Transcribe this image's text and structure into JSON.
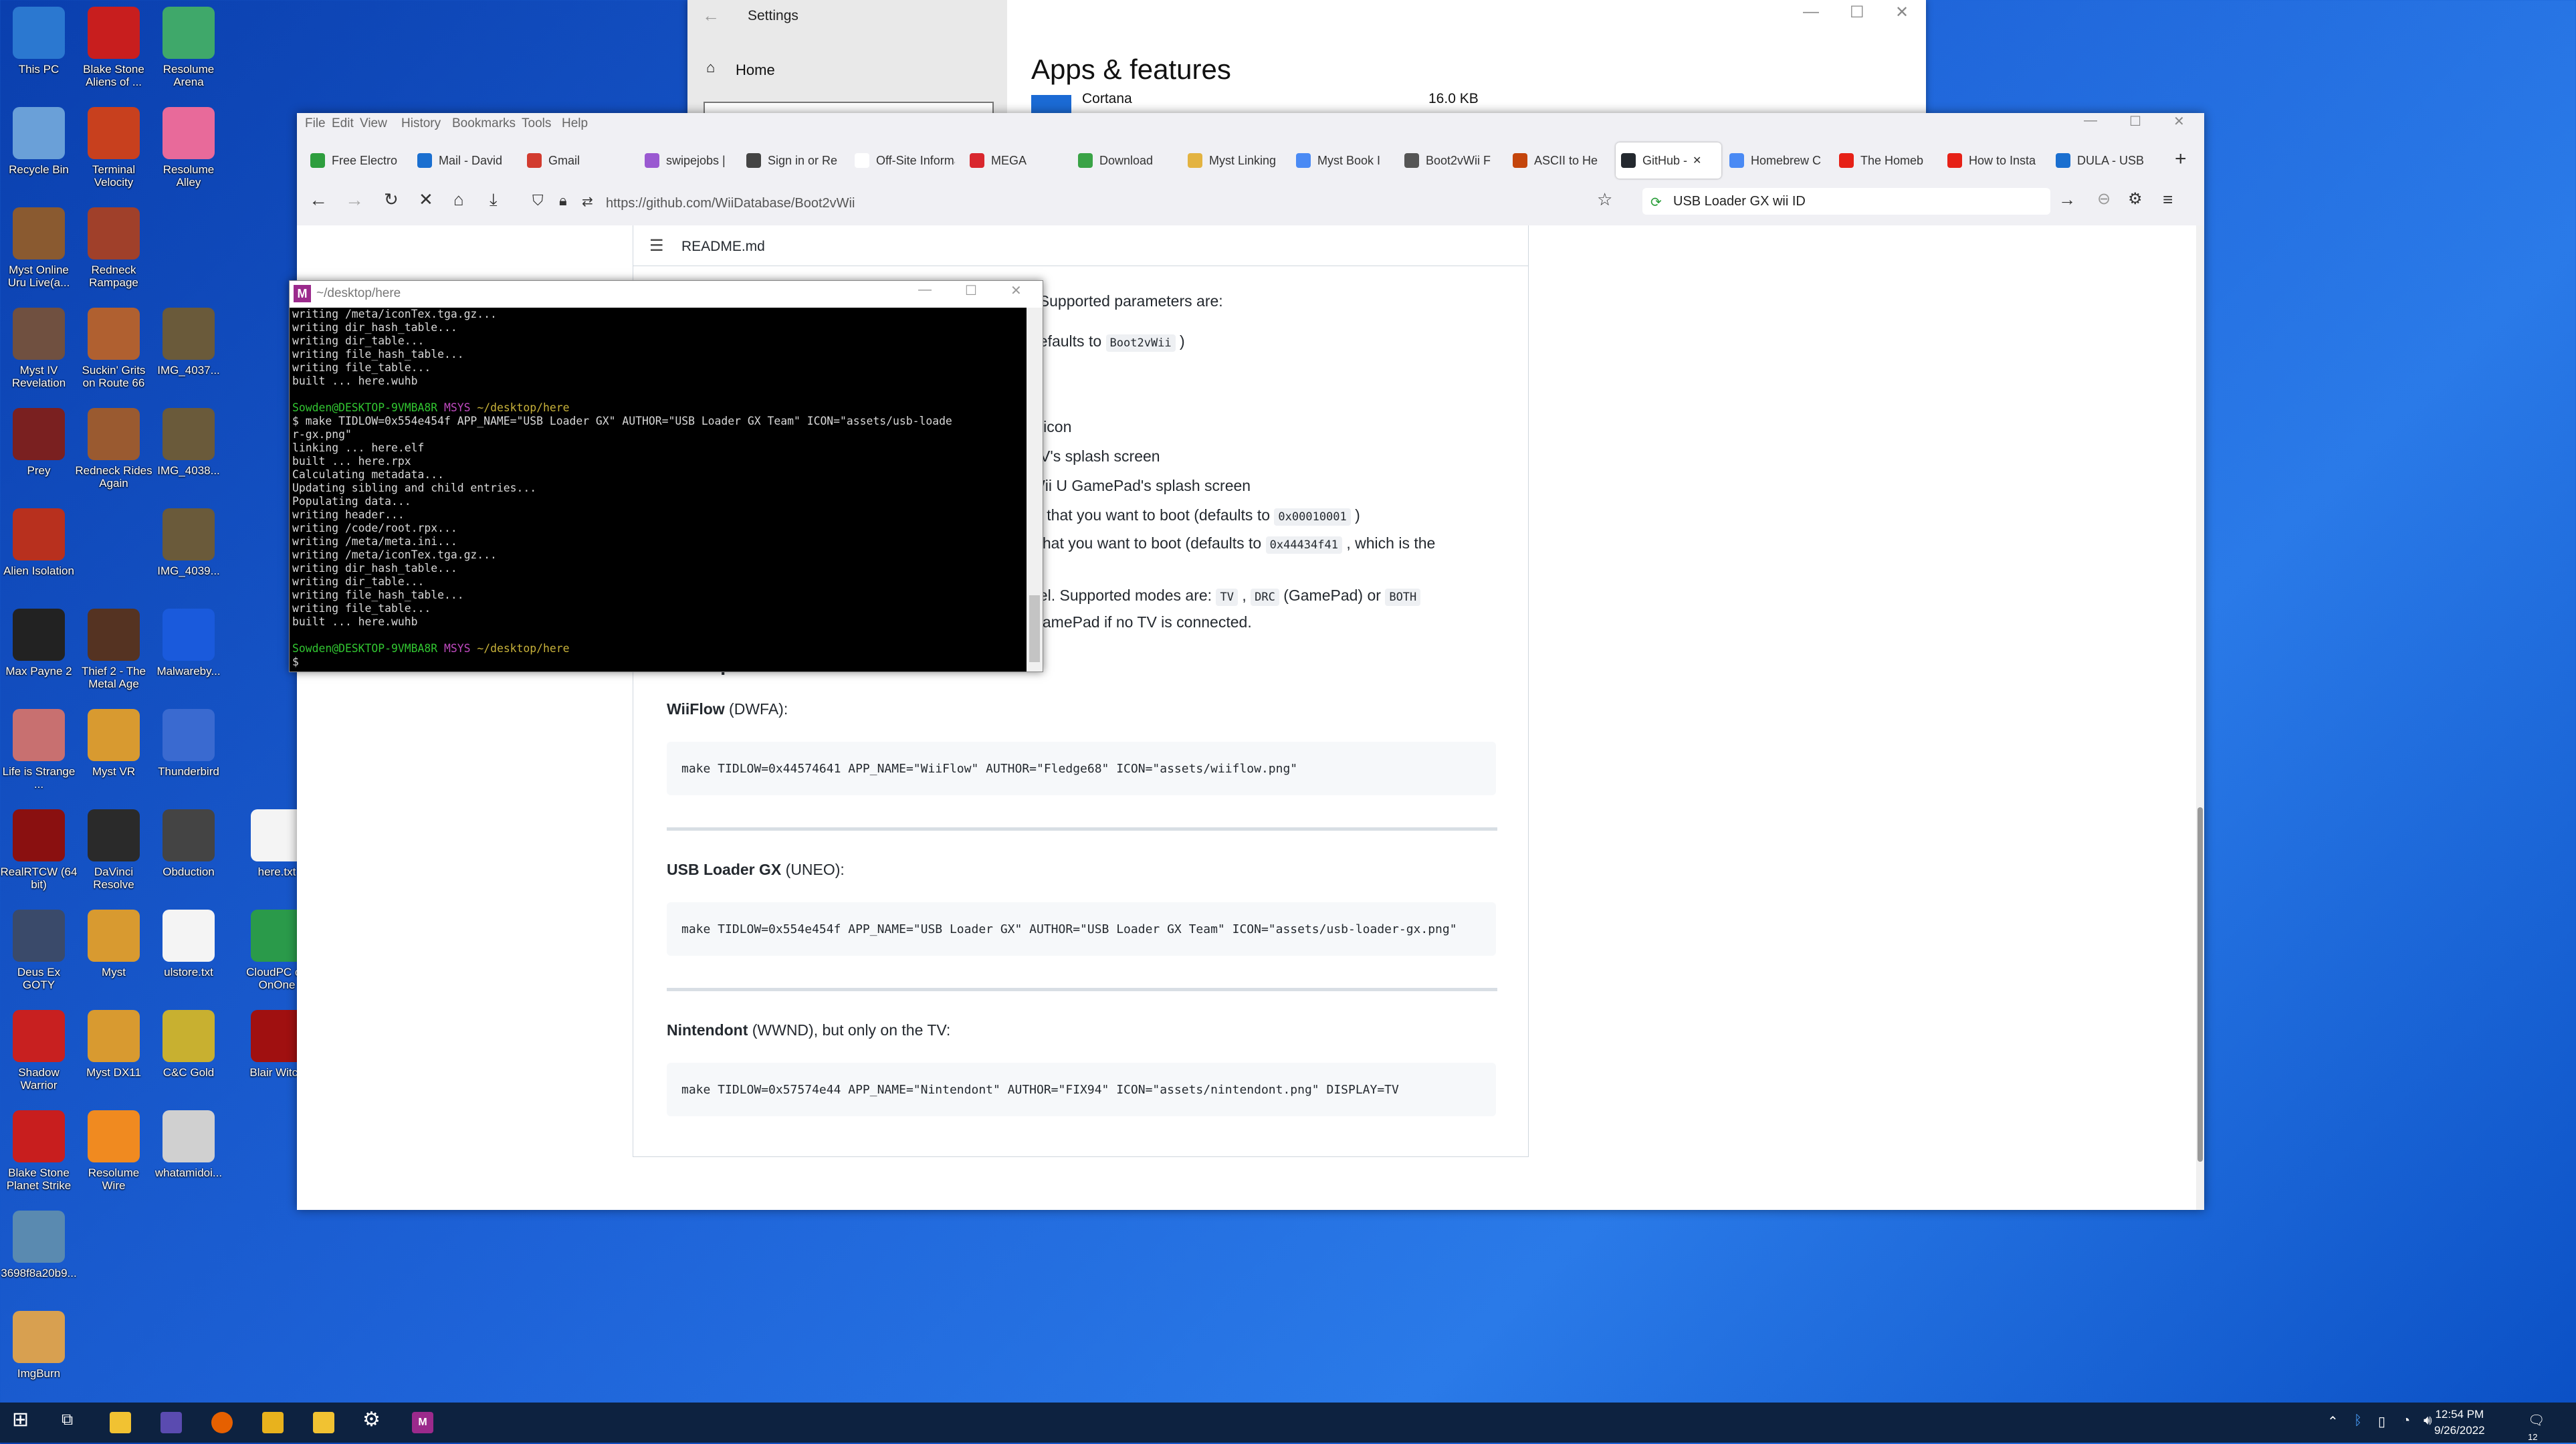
{
  "desktop": {
    "icons": [
      {
        "label": "This PC"
      },
      {
        "label": "Blake Stone Aliens of ..."
      },
      {
        "label": "Resolume Arena"
      },
      {
        "label": "Recycle Bin"
      },
      {
        "label": "Terminal Velocity"
      },
      {
        "label": "Resolume Alley"
      },
      {
        "label": "Myst Online Uru Live(a..."
      },
      {
        "label": "Redneck Rampage"
      },
      {
        "label": "Myst IV Revelation"
      },
      {
        "label": "Suckin' Grits on Route 66"
      },
      {
        "label": "IMG_4037..."
      },
      {
        "label": "Prey"
      },
      {
        "label": "Redneck Rides Again"
      },
      {
        "label": "IMG_4038..."
      },
      {
        "label": "Alien Isolation"
      },
      {
        "label": "IMG_4039..."
      },
      {
        "label": "Max Payne 2"
      },
      {
        "label": "Thief 2 - The Metal Age"
      },
      {
        "label": "Malwareby..."
      },
      {
        "label": "Life is Strange ..."
      },
      {
        "label": "Myst VR"
      },
      {
        "label": "Thunderbird"
      },
      {
        "label": "RealRTCW (64 bit)"
      },
      {
        "label": "DaVinci Resolve"
      },
      {
        "label": "Obduction"
      },
      {
        "label": "here.txt"
      },
      {
        "label": "Deus Ex GOTY"
      },
      {
        "label": "Myst"
      },
      {
        "label": "ulstore.txt"
      },
      {
        "label": "CloudPC on OnOne"
      },
      {
        "label": "Shadow Warrior"
      },
      {
        "label": "Myst DX11"
      },
      {
        "label": "C&C Gold"
      },
      {
        "label": "Blair Witch"
      },
      {
        "label": "Blake Stone Planet Strike"
      },
      {
        "label": "Resolume Wire"
      },
      {
        "label": "whatamidoi..."
      },
      {
        "label": "3698f8a20b9..."
      },
      {
        "label": "ImgBurn"
      }
    ]
  },
  "settings": {
    "title": "Settings",
    "home": "Home",
    "heading": "Apps & features",
    "app_name": "Cortana",
    "app_size": "16.0 KB"
  },
  "firefox": {
    "menu": [
      "File",
      "Edit",
      "View",
      "History",
      "Bookmarks",
      "Tools",
      "Help"
    ],
    "tabs": [
      {
        "label": "Free Electro",
        "color": "#2e9e3e"
      },
      {
        "label": "Mail - David",
        "color": "#1a6fd0"
      },
      {
        "label": "Gmail",
        "color": "#d23b2f"
      },
      {
        "label": "swipejobs |",
        "color": "#9a59d1"
      },
      {
        "label": "Sign in or Re",
        "color": "#444444"
      },
      {
        "label": "Off-Site Informa",
        "color": "#ffffff"
      },
      {
        "label": "MEGA",
        "color": "#d9272e"
      },
      {
        "label": "Download",
        "color": "#3aa346"
      },
      {
        "label": "Myst Linking",
        "color": "#e3b341"
      },
      {
        "label": "Myst Book I",
        "color": "#4a8af4"
      },
      {
        "label": "Boot2vWii F",
        "color": "#555555"
      },
      {
        "label": "ASCII to He",
        "color": "#c4450c"
      },
      {
        "label": "GitHub -",
        "color": "#24292f"
      },
      {
        "label": "Homebrew C",
        "color": "#4a8af4"
      },
      {
        "label": "The Homeb",
        "color": "#e62117"
      },
      {
        "label": "How to Insta",
        "color": "#e62117"
      },
      {
        "label": "DULA - USB",
        "color": "#1a6fd0"
      }
    ],
    "active_tab": 12,
    "url": "https://github.com/WiiDatabase/Boot2vWii",
    "search_value": "USB Loader GX wii ID",
    "readme": "README.md",
    "visible_lines": [
      "! Supported parameters are:",
      "defaults to",
      "u icon",
      "TV's splash screen",
      "Wii U GamePad's splash screen",
      "el that you want to boot (defaults to",
      "l that you want to boot (defaults to",
      ", which is the",
      "nel. Supported modes are:",
      "(GamePad) or",
      "GamePad if no TV is connected."
    ],
    "code_boot2vwii": "Boot2vWii",
    "code_tidhigh": "0x00010001",
    "code_tidlow": "0x44434f41",
    "code_tv": "TV",
    "code_drc": "DRC",
    "code_both": "BOTH",
    "code_close": ")",
    "examples_heading": "Examples",
    "examples": [
      {
        "name": "WiiFlow",
        "suffix": " (DWFA):",
        "command": "make TIDLOW=0x44574641 APP_NAME=\"WiiFlow\" AUTHOR=\"Fledge68\" ICON=\"assets/wiiflow.png\""
      },
      {
        "name": "USB Loader GX",
        "suffix": " (UNEO):",
        "command": "make TIDLOW=0x554e454f APP_NAME=\"USB Loader GX\" AUTHOR=\"USB Loader GX Team\" ICON=\"assets/usb-loader-gx.png\""
      },
      {
        "name": "Nintendont",
        "suffix": " (WWND), but only on the TV:",
        "command": "make TIDLOW=0x57574e44 APP_NAME=\"Nintendont\" AUTHOR=\"FIX94\" ICON=\"assets/nintendont.png\" DISPLAY=TV"
      }
    ]
  },
  "terminal": {
    "title": "~/desktop/here",
    "lines": [
      "writing /meta/iconTex.tga.gz...",
      "writing dir_hash_table...",
      "writing dir_table...",
      "writing file_hash_table...",
      "writing file_table...",
      "built ... here.wuhb",
      "",
      "PROMPT",
      "$ make TIDLOW=0x554e454f APP_NAME=\"USB Loader GX\" AUTHOR=\"USB Loader GX Team\" ICON=\"assets/usb-loade",
      "r-gx.png\"",
      "linking ... here.elf",
      "built ... here.rpx",
      "Calculating metadata...",
      "Updating sibling and child entries...",
      "Populating data...",
      "writing header...",
      "writing /code/root.rpx...",
      "writing /meta/meta.ini...",
      "writing /meta/iconTex.tga.gz...",
      "writing dir_hash_table...",
      "writing dir_table...",
      "writing file_hash_table...",
      "writing file_table...",
      "built ... here.wuhb",
      "",
      "PROMPT",
      "$"
    ],
    "prompt_user": "Sowden@DESKTOP-9VMBA8R",
    "prompt_sys": "MSYS",
    "prompt_path": "~/desktop/here"
  },
  "taskbar": {
    "time": "12:54 PM",
    "date": "9/26/2022",
    "notification_count": "12"
  }
}
